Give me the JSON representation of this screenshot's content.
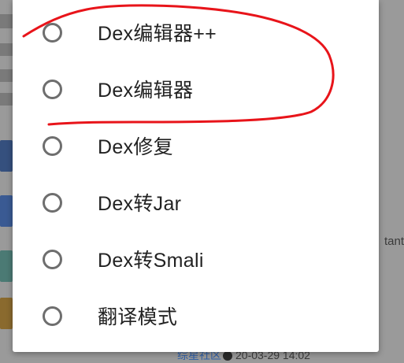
{
  "dialog": {
    "options": [
      {
        "label": "Dex编辑器++",
        "selected": false
      },
      {
        "label": "Dex编辑器",
        "selected": false
      },
      {
        "label": "Dex修复",
        "selected": false
      },
      {
        "label": "Dex转Jar",
        "selected": false
      },
      {
        "label": "Dex转Smali",
        "selected": false
      },
      {
        "label": "翻译模式",
        "selected": false
      }
    ]
  },
  "background": {
    "right_text": "tant",
    "footer_link": "综星社区",
    "footer_date": "20-03-29 14:02"
  },
  "annotation": {
    "color": "#e8141a"
  }
}
